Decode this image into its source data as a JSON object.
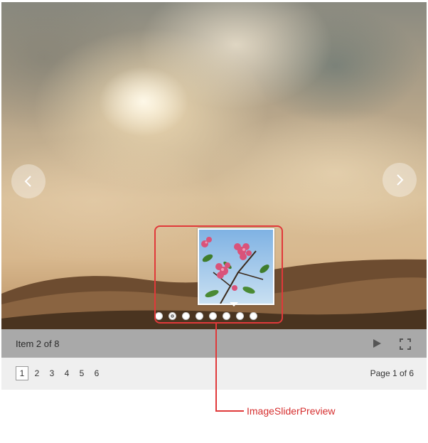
{
  "slider": {
    "prev_icon": "chevron-left-icon",
    "next_icon": "chevron-right-icon",
    "dot_count": 8,
    "active_dot_index": 1
  },
  "info_bar": {
    "counter_text": "Item 2 of 8",
    "play_icon": "play-icon",
    "fullscreen_icon": "fullscreen-icon"
  },
  "pager": {
    "pages": [
      "1",
      "2",
      "3",
      "4",
      "5",
      "6"
    ],
    "active_page": "1",
    "page_info": "Page 1 of 6"
  },
  "callout": {
    "label": "ImageSliderPreview",
    "color": "#e0393a"
  }
}
